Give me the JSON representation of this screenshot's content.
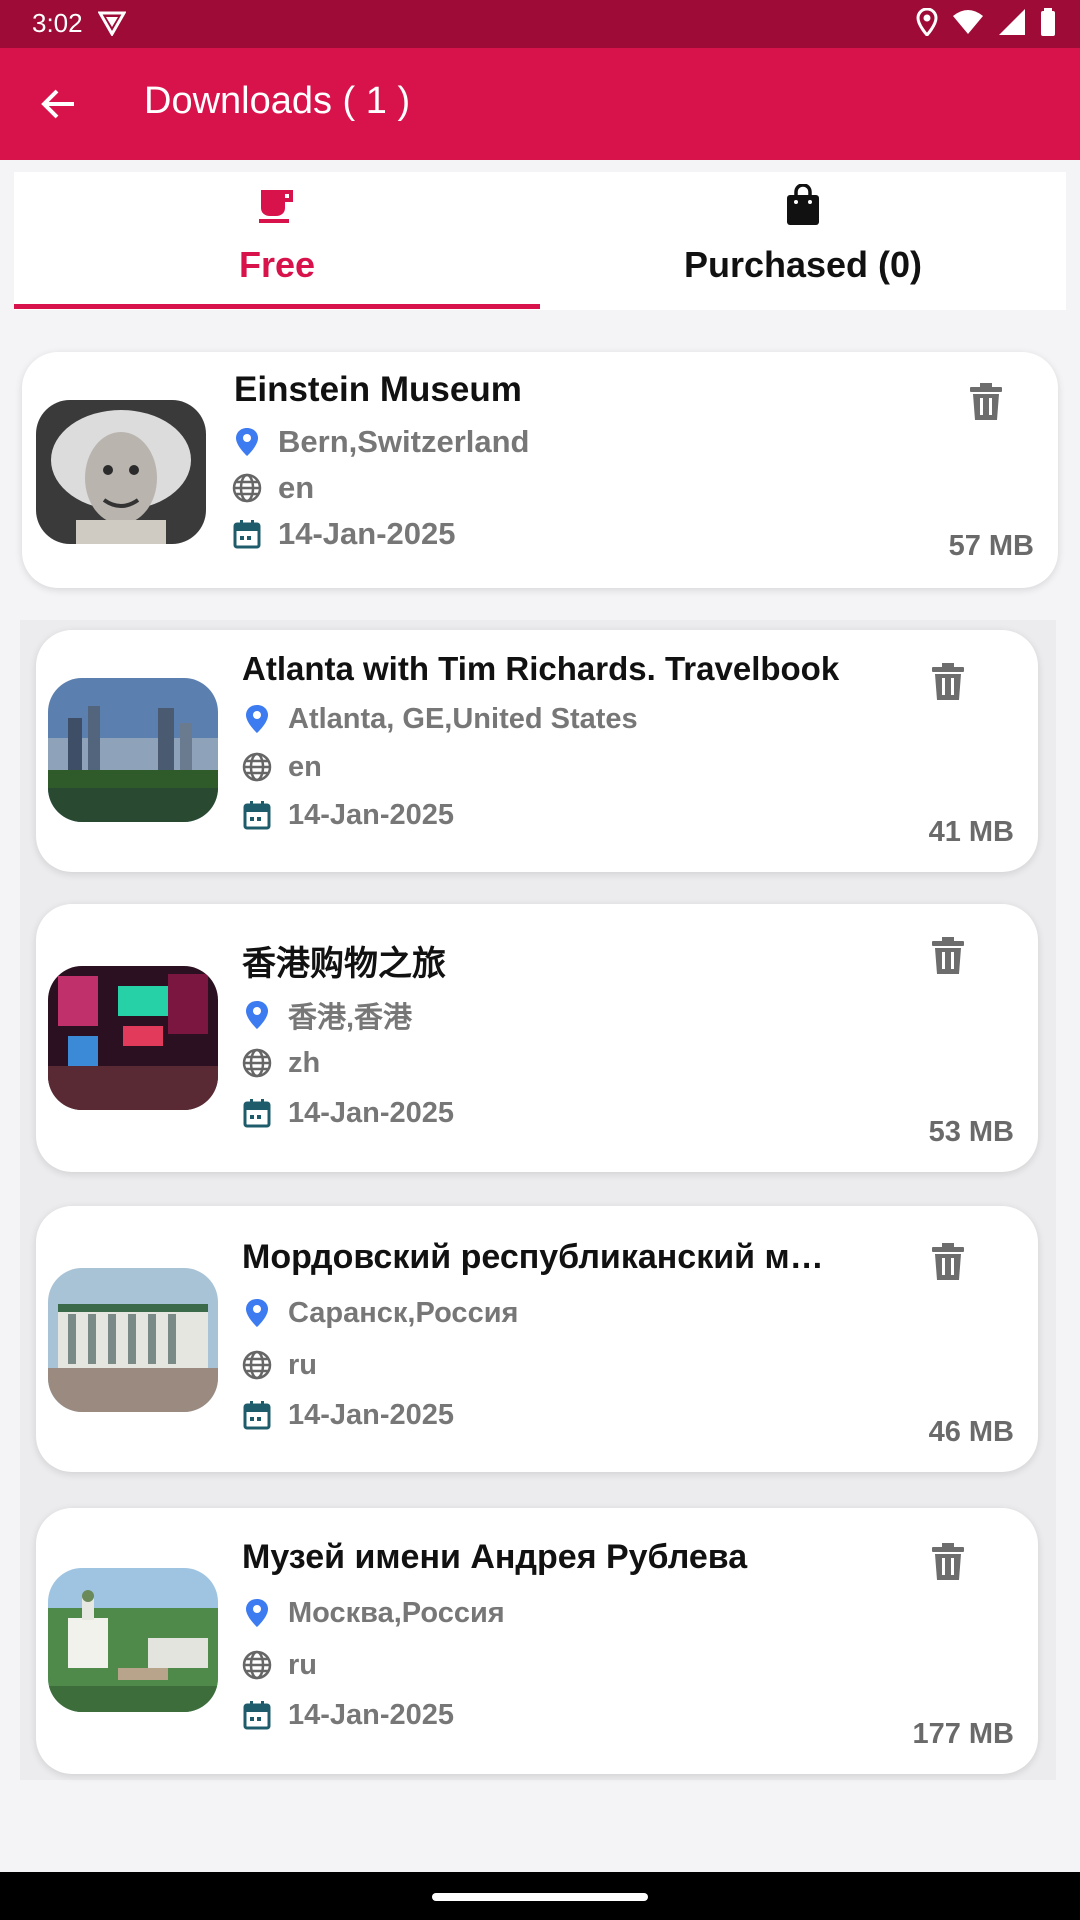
{
  "status_bar": {
    "time": "3:02"
  },
  "app_bar": {
    "title": "Downloads ( 1 )"
  },
  "tabs": [
    {
      "label": "Free",
      "icon": "mug-icon",
      "selected": true
    },
    {
      "label": "Purchased (0)",
      "icon": "shopping-bag-icon",
      "selected": false
    }
  ],
  "downloads": [
    {
      "title": "Einstein Museum",
      "location": "Bern,Switzerland",
      "language": "en",
      "date": "14-Jan-2025",
      "size": "57 MB"
    },
    {
      "title": "Atlanta with Tim Richards. Travelbook",
      "location": "Atlanta, GE,United States",
      "language": "en",
      "date": "14-Jan-2025",
      "size": "41 MB"
    },
    {
      "title": "香港购物之旅",
      "location": "香港,香港",
      "language": "zh",
      "date": "14-Jan-2025",
      "size": "53 MB"
    },
    {
      "title": "Мордовский республиканский м…",
      "location": "Саранск,Россия",
      "language": "ru",
      "date": "14-Jan-2025",
      "size": "46 MB"
    },
    {
      "title": "Музей имени Андрея Рублева",
      "location": "Москва,Россия",
      "language": "ru",
      "date": "14-Jan-2025",
      "size": "177 MB"
    }
  ],
  "colors": {
    "primary": "#d8124a",
    "status_bar": "#9e0b36",
    "pin": "#3d7bf0",
    "calendar": "#1f5c6b"
  }
}
